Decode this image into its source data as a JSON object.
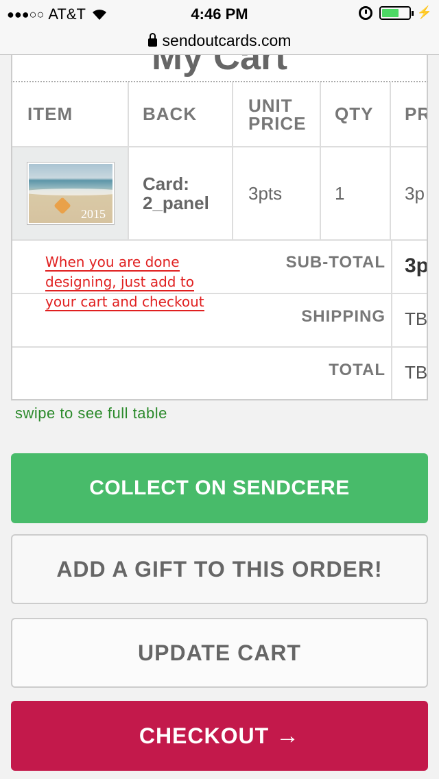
{
  "status_bar": {
    "signal": "●●●○○",
    "carrier": "AT&T",
    "time": "4:46 PM",
    "battery_level": 0.65,
    "battery_color": "#4cd964"
  },
  "browser": {
    "url": "sendoutcards.com",
    "lock_icon": "lock-icon"
  },
  "cart": {
    "title": "My Cart",
    "columns": [
      "ITEM",
      "BACK",
      "UNIT PRICE",
      "QTY",
      "PR"
    ],
    "item": {
      "thumbnail_caption": "2015",
      "back": "Card: 2_panel",
      "unit_price": "3pts",
      "qty": "1",
      "price": "3p"
    },
    "summary": {
      "subtotal_label": "SUB-TOTAL",
      "subtotal_value": "3p",
      "shipping_label": "SHIPPING",
      "shipping_value": "TB",
      "total_label": "TOTAL",
      "total_value": "TB"
    },
    "annotation": "When you are done designing, just add to your cart and checkout",
    "swipe_hint": "swipe to see full table"
  },
  "buttons": {
    "collect": "COLLECT ON SENDCERE",
    "gift": "ADD A GIFT TO THIS ORDER!",
    "update": "UPDATE CART",
    "checkout": "CHECKOUT",
    "checkout_arrow": "→"
  },
  "colors": {
    "collect": "#48bb6a",
    "checkout": "#c3194b",
    "annotation": "#e02020",
    "swipe_hint": "#2b8a2b"
  }
}
